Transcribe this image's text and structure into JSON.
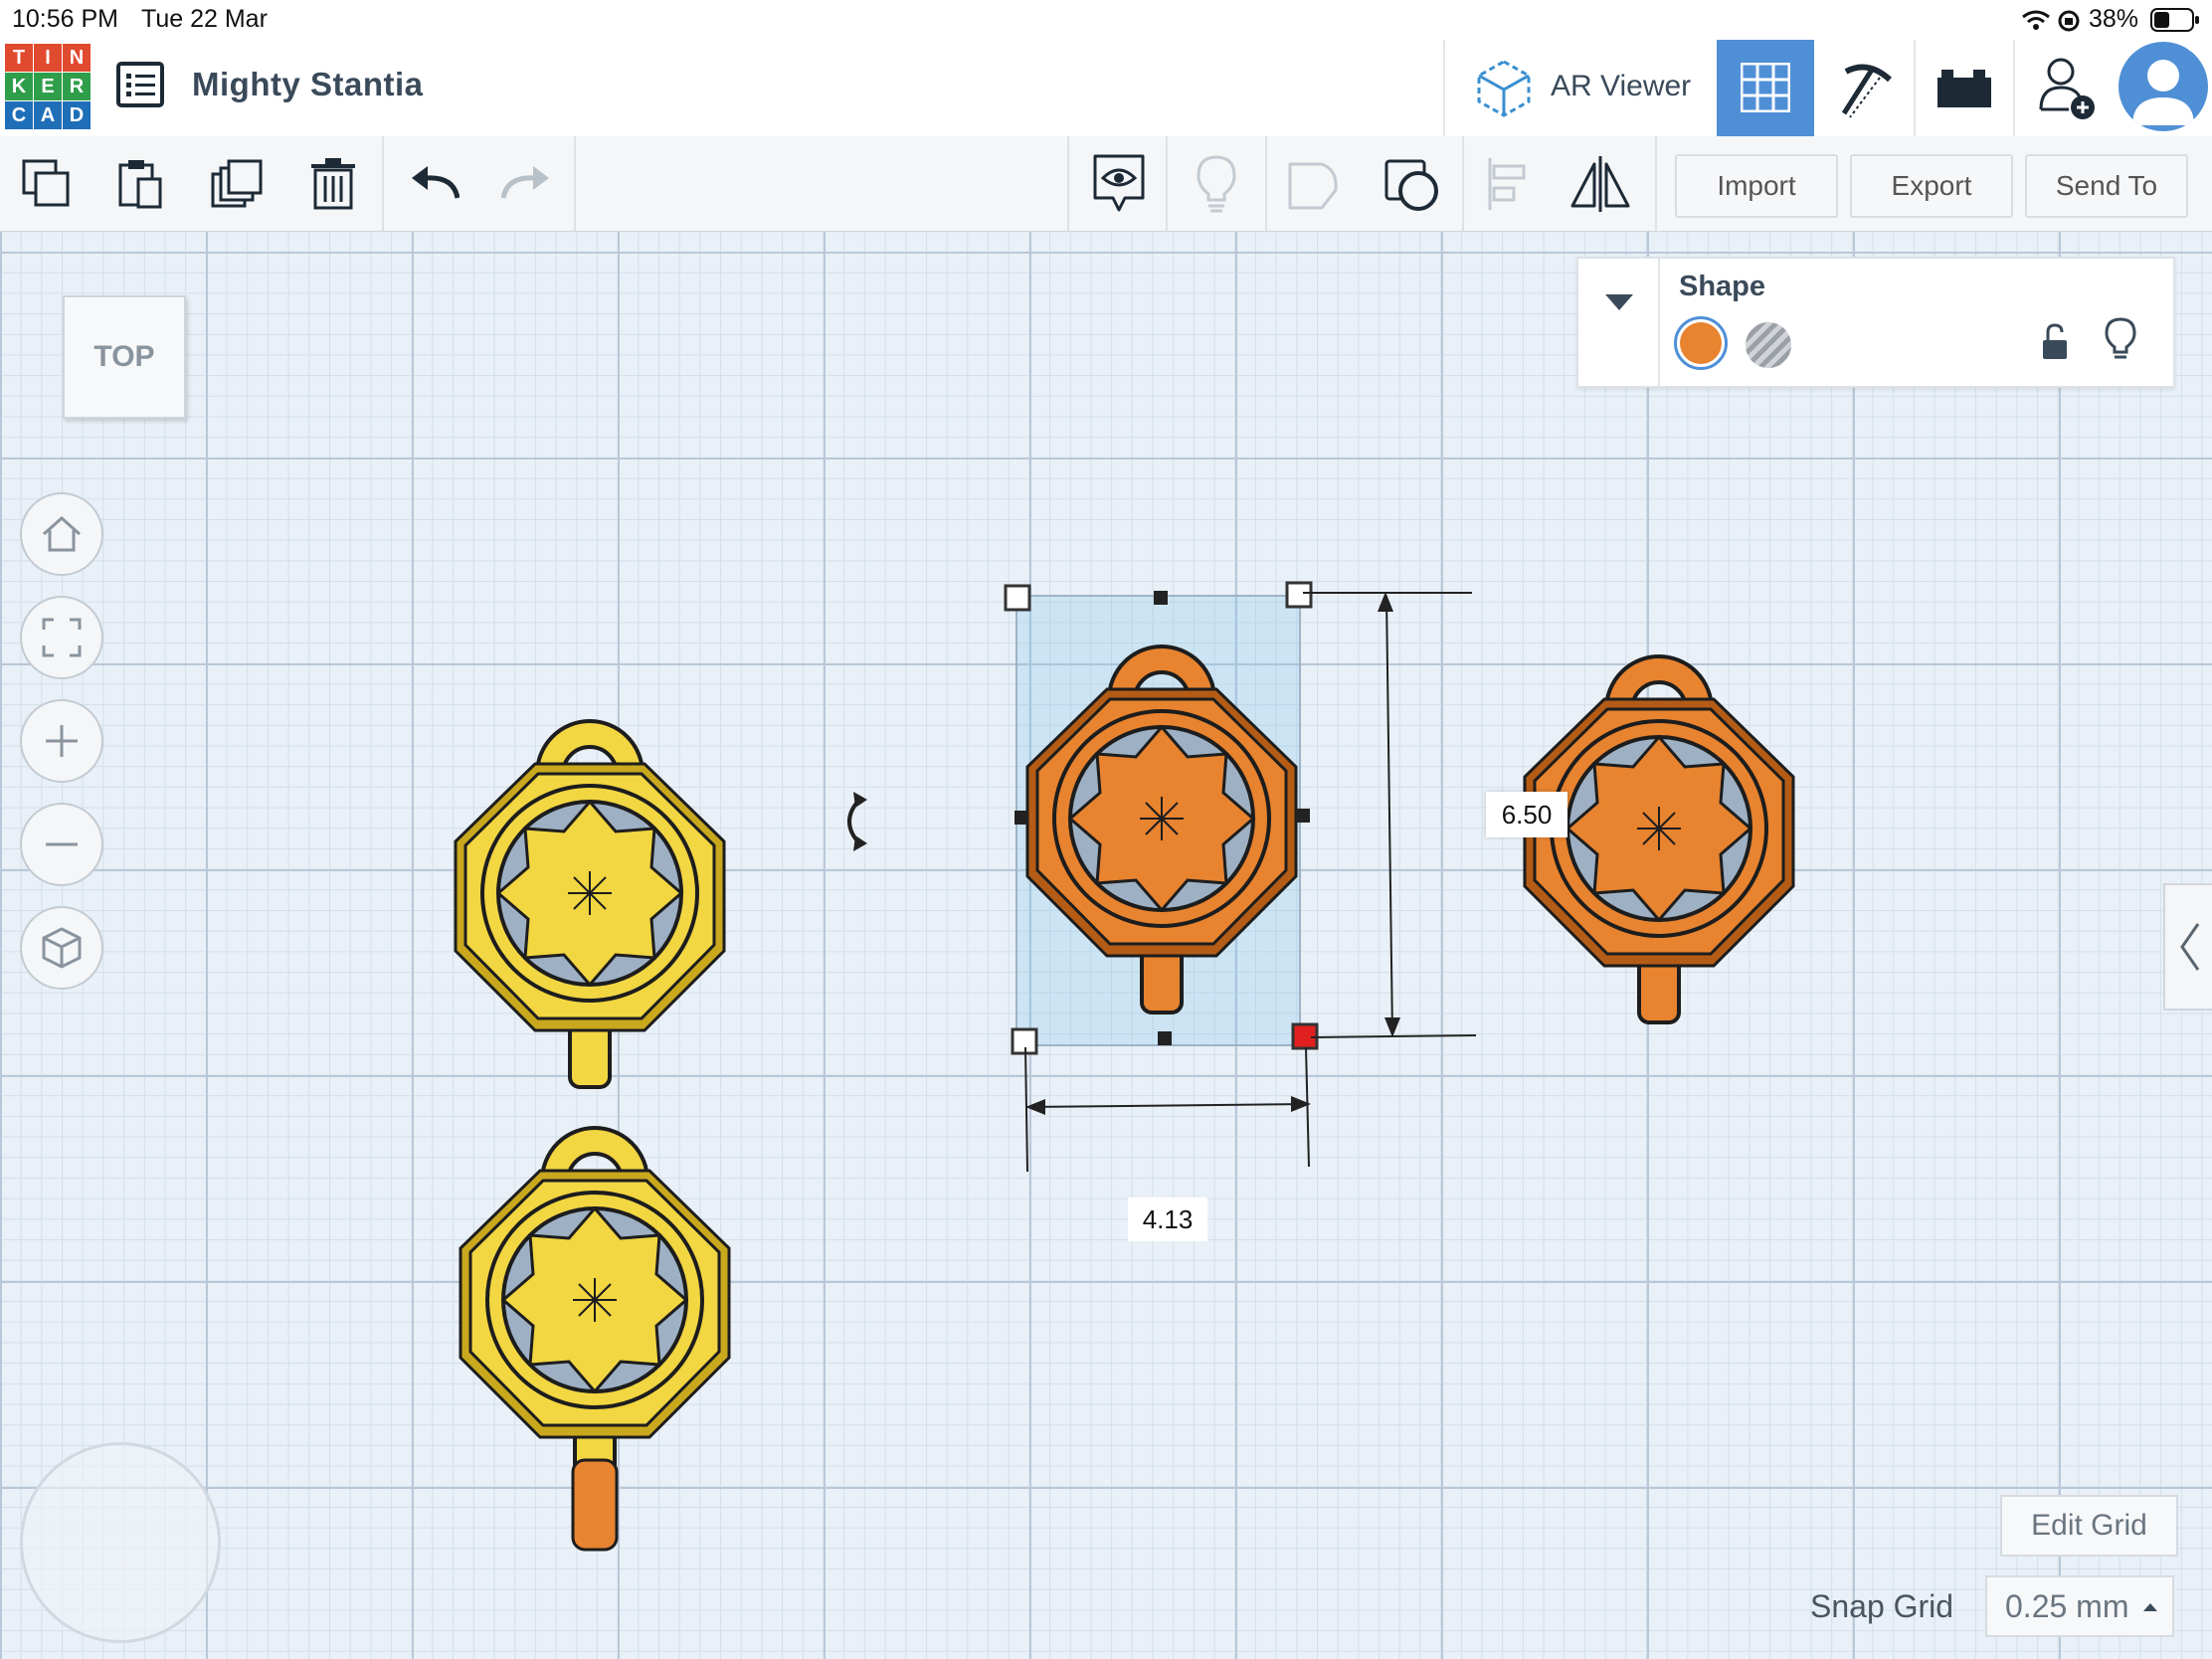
{
  "status_bar": {
    "time": "10:56 PM",
    "date": "Tue 22 Mar",
    "battery": "38%"
  },
  "logo": {
    "letters": [
      "T",
      "I",
      "N",
      "K",
      "E",
      "R",
      "C",
      "A",
      "D"
    ],
    "colors": [
      "#e04a2f",
      "#e04a2f",
      "#e04a2f",
      "#2f9e4a",
      "#2f9e4a",
      "#2f9e4a",
      "#1f6fb8",
      "#1f6fb8",
      "#1f6fb8"
    ]
  },
  "header": {
    "project_title": "Mighty Stantia",
    "ar_viewer_label": "AR Viewer"
  },
  "toolbar": {
    "import_label": "Import",
    "export_label": "Export",
    "send_to_label": "Send To"
  },
  "viewcube": {
    "face_label": "TOP"
  },
  "shape_panel": {
    "title": "Shape",
    "solid_color": "#e8832f"
  },
  "dimensions": {
    "width": "4.13",
    "height": "6.50"
  },
  "grid_controls": {
    "edit_grid_label": "Edit Grid",
    "snap_grid_label": "Snap Grid",
    "snap_grid_value": "0.25 mm"
  },
  "colors": {
    "accent_blue": "#4f8fd6",
    "shape_orange": "#e8832f",
    "shape_yellow": "#f2d642",
    "selection_red": "#e02020"
  }
}
